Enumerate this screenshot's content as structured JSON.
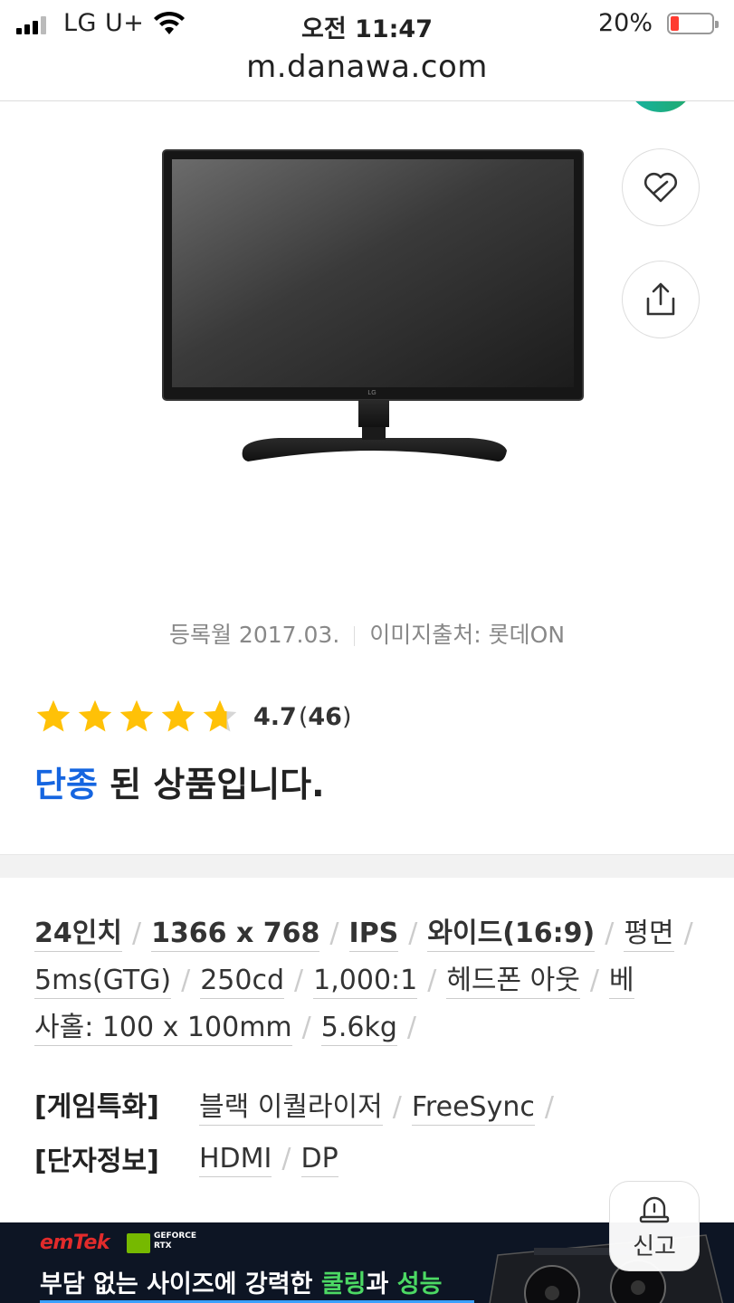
{
  "status_bar": {
    "carrier": "LG U+",
    "time": "오전 11:47",
    "battery_percent": "20%",
    "battery_level": 0.2,
    "battery_color": "#ff3b30"
  },
  "browser": {
    "url": "m.danawa.com"
  },
  "product": {
    "image_icon": "monitor-image",
    "registered": "등록월 2017.03.",
    "image_source": "이미지출처: 롯데ON",
    "rating_value": 4.7,
    "score": "4.7",
    "count_open": "(",
    "review_count": "46",
    "count_close": ")",
    "discontinued_highlight": "단종",
    "discontinued_rest": " 된 상품입니다.",
    "accent_color": "#1565e0",
    "star_color": "#ffc107"
  },
  "actions": {
    "wishlist_icon": "heart-link-icon",
    "share_icon": "share-icon"
  },
  "specs": {
    "line1": [
      "24인치",
      "1366 x 768",
      "IPS",
      "와이드(16:9)",
      "평면"
    ],
    "line2": [
      "5ms(GTG)",
      "250cd",
      "1,000:1",
      "헤드폰 아웃",
      "베"
    ],
    "line3": [
      "사홀: 100 x 100mm",
      "5.6kg"
    ],
    "gaming_label": "[게임특화]",
    "gaming_items": [
      "블랙 이퀄라이저",
      "FreeSync"
    ],
    "port_label": "[단자정보]",
    "port_items": [
      "HDMI",
      "DP"
    ]
  },
  "banner": {
    "brand": "emTek",
    "gf_line1": "GEFORCE",
    "gf_line2": "RTX",
    "text_a": "부담 없는 사이즈에 강력한 ",
    "text_b": "쿨링",
    "text_c": "과 ",
    "text_d": "성능"
  },
  "report": {
    "label": "신고",
    "icon": "siren-icon"
  }
}
